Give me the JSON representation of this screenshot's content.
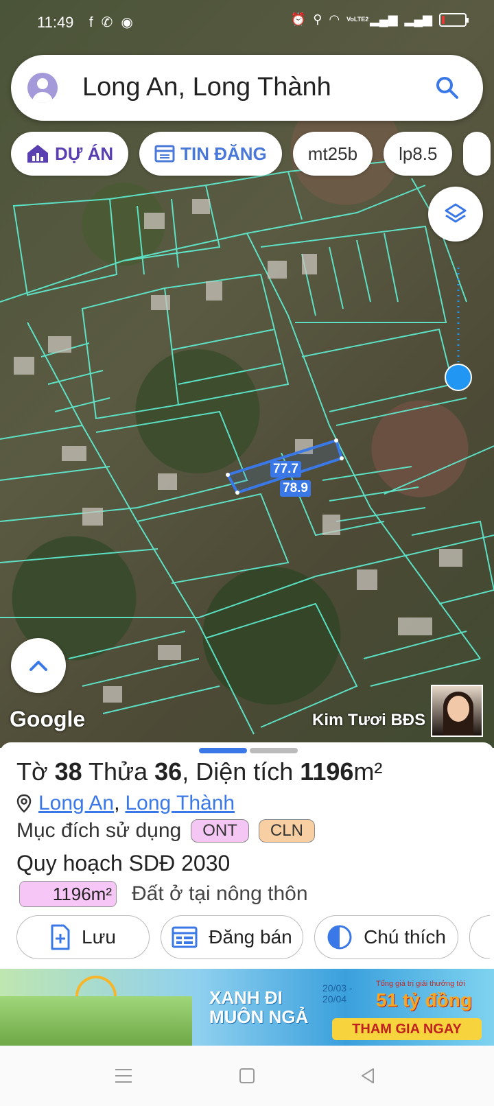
{
  "status_bar": {
    "time": "11:49",
    "network_label": "VoLTE2"
  },
  "search": {
    "text": "Long An, Long Thành"
  },
  "chips": [
    {
      "label": "DỰ ÁN"
    },
    {
      "label": "TIN ĐĂNG"
    },
    {
      "label": "mt25b"
    },
    {
      "label": "lp8.5"
    }
  ],
  "map": {
    "measurement_top": "77.7",
    "measurement_bottom": "78.9",
    "google_logo": "Google",
    "watermark": "Kim Tươi BĐS"
  },
  "parcel": {
    "prefix_sheet": "Tờ ",
    "sheet": "38",
    "prefix_lot": " Thửa ",
    "lot": "36",
    "prefix_area": ", Diện tích ",
    "area": "1196",
    "area_unit": "m²",
    "province": "Long An",
    "district": "Long Thành",
    "separator": ",",
    "purpose_label": "Mục đích sử dụng",
    "purpose_tags": [
      "ONT",
      "CLN"
    ],
    "plan_label": "Quy hoạch SDĐ 2030",
    "plan_area": "1196m²",
    "plan_desc": "Đất ở tại nông thôn"
  },
  "actions": [
    {
      "label": "Lưu"
    },
    {
      "label": "Đăng bán"
    },
    {
      "label": "Chú thích"
    }
  ],
  "ad": {
    "headline": "XANH ĐI MUÔN NGẢ",
    "date": "20/03 - 20/04",
    "prize_label": "Tổng giá trị giải thưởng tới",
    "prize": "51 tỷ đồng",
    "cta": "THAM GIA NGAY"
  },
  "colors": {
    "accent": "#3b78e7",
    "parcel_lines": "#5ff0d4",
    "purple": "#5a3fb0"
  }
}
